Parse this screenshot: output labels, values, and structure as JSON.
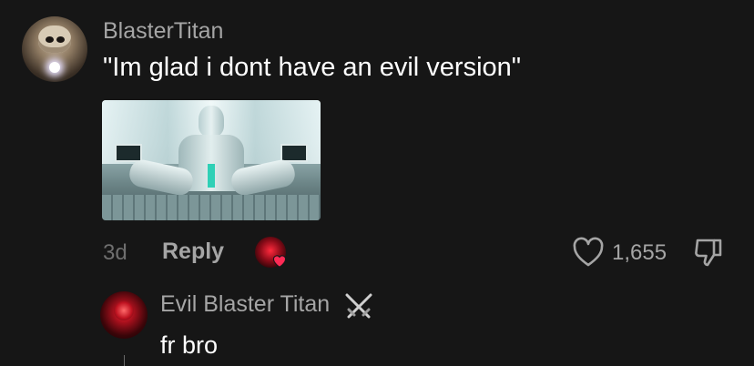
{
  "comment": {
    "username": "BlasterTitan",
    "text": "\"Im glad i dont have an evil version\"",
    "time": "3d",
    "reply_label": "Reply",
    "like_count": "1,655"
  },
  "reply": {
    "username": "Evil Blaster Titan",
    "text": "fr bro"
  },
  "colors": {
    "background": "#161616",
    "secondary_text": "#a5a5a5",
    "primary_text": "#ffffff",
    "muted_text": "#6f6f6f",
    "creator_heart": "#ff2a55"
  },
  "icons": {
    "like": "heart-outline-icon",
    "dislike": "thumbs-down-icon",
    "creator_like": "creator-heart-icon",
    "badge": "crossed-swords-icon"
  }
}
